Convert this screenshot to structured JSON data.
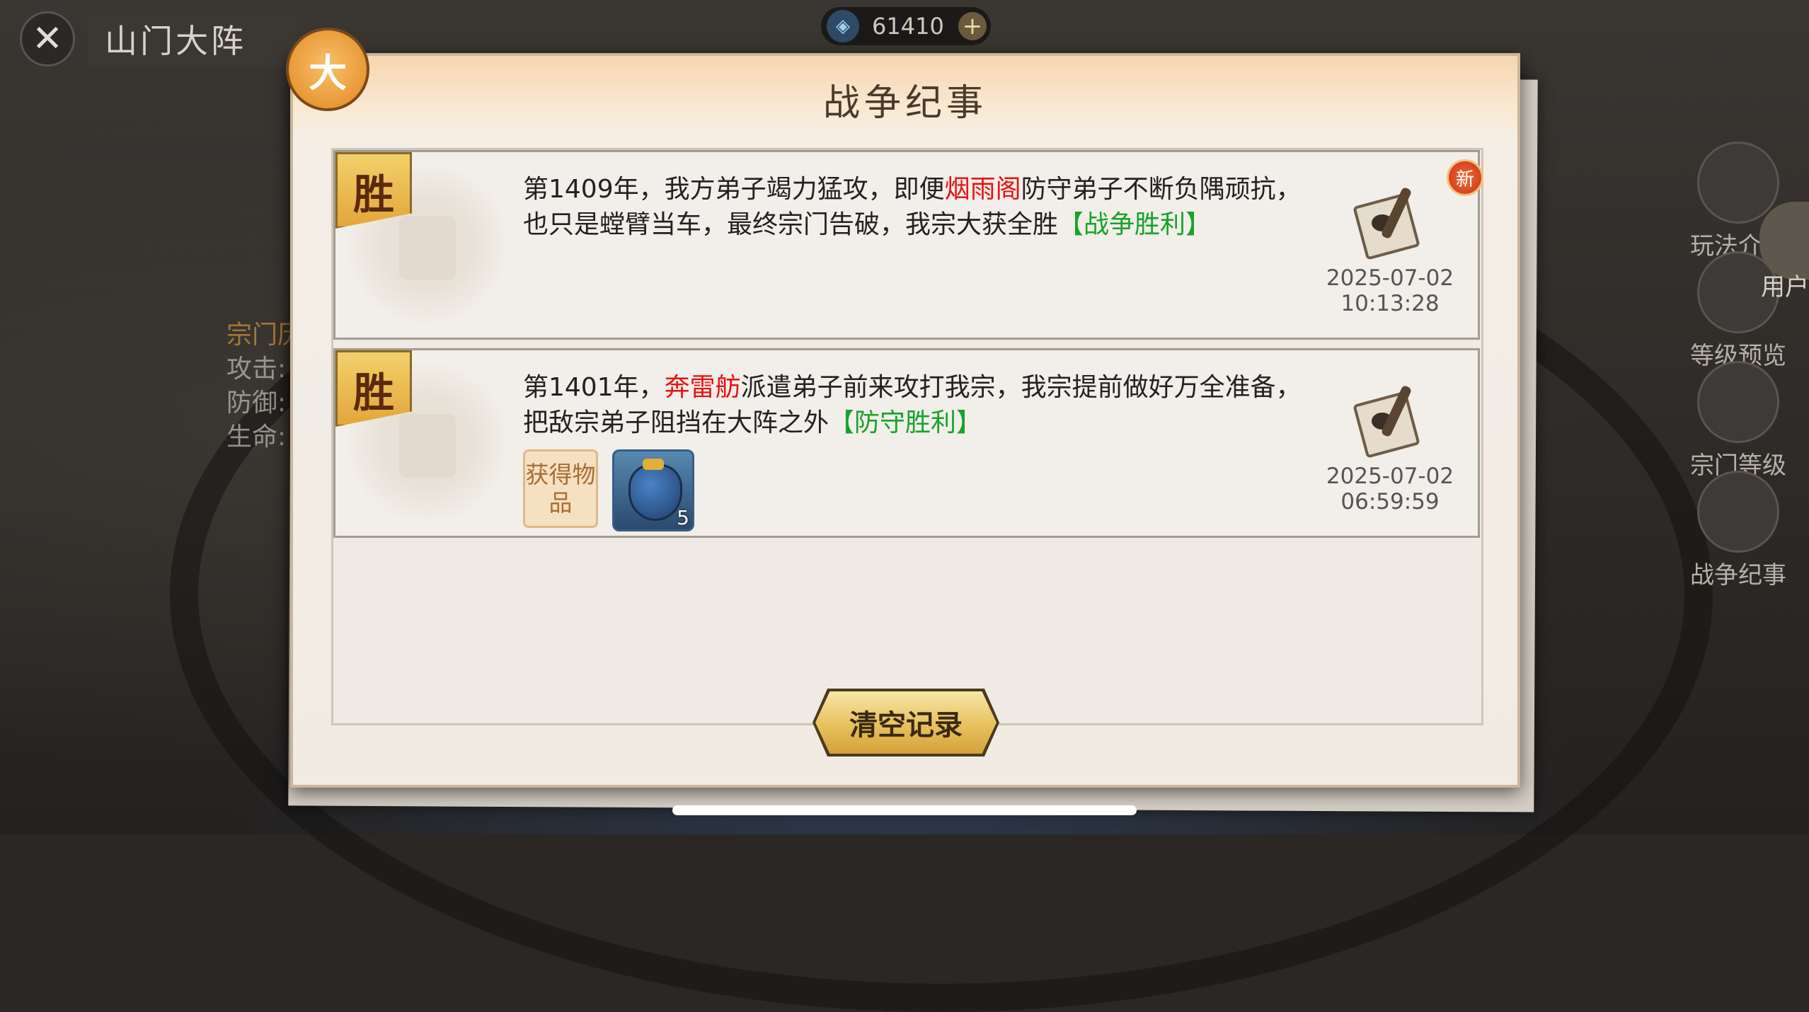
{
  "scene": {
    "title": "山门大阵",
    "stats": {
      "line1": "宗门历",
      "attack": "攻击:",
      "defense": "防御:",
      "life": "生命:"
    }
  },
  "currency": {
    "value": "61410",
    "icon": "spirit-stone-icon",
    "plus": "+"
  },
  "side_menu": [
    {
      "label": "玩法介绍",
      "icon": "book-icon"
    },
    {
      "label": "等级预览",
      "icon": "scroll-icon"
    },
    {
      "label": "宗门等级",
      "icon": "pavilion-icon"
    },
    {
      "label": "战争纪事",
      "icon": "chronicle-icon"
    }
  ],
  "user_label": "用户",
  "dialog": {
    "title": "战争纪事",
    "badge_icon": "cat-emblem-icon",
    "records": [
      {
        "result": "胜",
        "new_badge": "新",
        "text_parts": [
          {
            "text": "第1409年，我方弟子竭力猛攻，即便",
            "style": "normal"
          },
          {
            "text": "烟雨阁",
            "style": "red"
          },
          {
            "text": "防守弟子不断负隅顽抗，也只是螳臂当车，最终宗门告破，我宗大获全胜",
            "style": "normal"
          },
          {
            "text": "【战争胜利】",
            "style": "green"
          }
        ],
        "date": "2025-07-02",
        "time": "10:13:28"
      },
      {
        "result": "胜",
        "text_parts": [
          {
            "text": "第1401年，",
            "style": "normal"
          },
          {
            "text": "奔雷舫",
            "style": "red"
          },
          {
            "text": "派遣弟子前来攻打我宗，我宗提前做好万全准备，把敌宗弟子阻挡在大阵之外",
            "style": "normal"
          },
          {
            "text": "【防守胜利】",
            "style": "green"
          }
        ],
        "reward_label": "获得物品",
        "reward_item": {
          "icon": "treasure-bag-icon",
          "count": "5"
        },
        "date": "2025-07-02",
        "time": "06:59:59"
      }
    ],
    "clear_button": "清空记录"
  },
  "colors": {
    "highlight_red": "#e41414",
    "highlight_green": "#17a32c"
  }
}
